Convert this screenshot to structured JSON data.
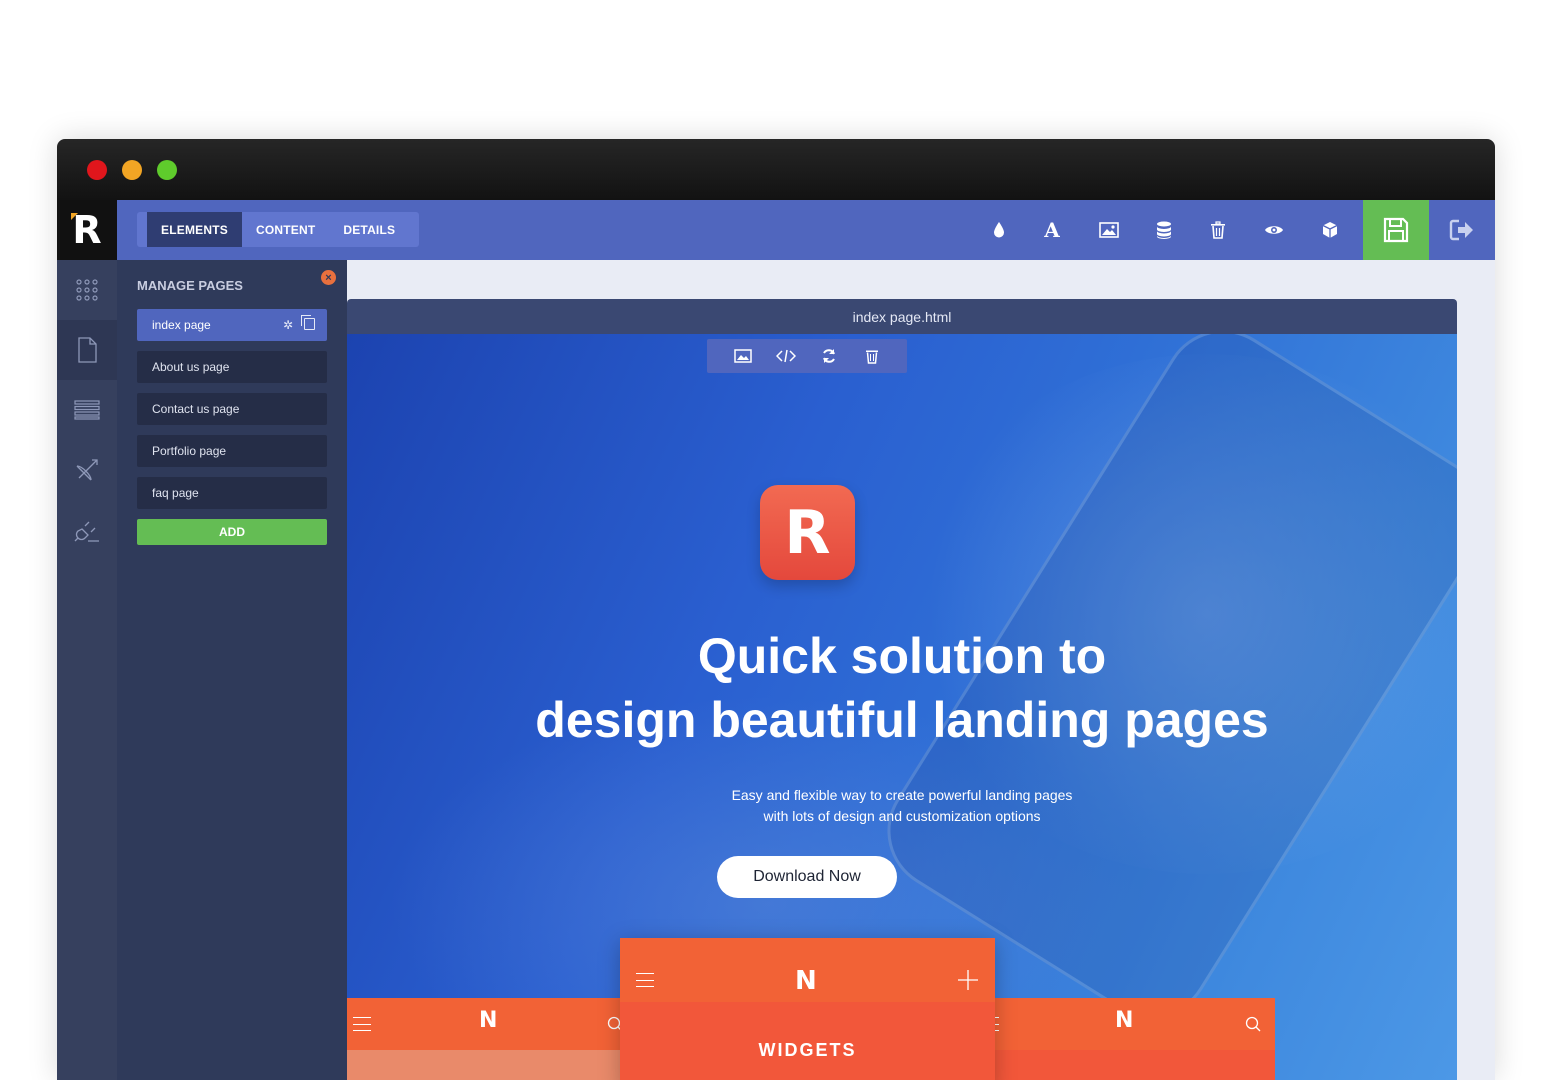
{
  "tabs": [
    "ELEMENTS",
    "CONTENT",
    "DETAILS"
  ],
  "toolbar_icons": [
    "droplet-icon",
    "font-icon",
    "image-icon",
    "database-icon",
    "trash-icon",
    "eye-icon",
    "cube-icon"
  ],
  "panel": {
    "title": "MANAGE PAGES",
    "pages": [
      "index page",
      "About us page",
      "Contact us page",
      "Portfolio page",
      "faq page"
    ],
    "add_label": "ADD"
  },
  "canvas": {
    "file_name": "index page.html"
  },
  "hero": {
    "logo_letter": "R",
    "headline_line1": "Quick solution to",
    "headline_line2": "design beautiful landing pages",
    "sub_line1": "Easy and flexible way to create powerful landing pages",
    "sub_line2": "with lots of design and customization options",
    "button": "Download Now"
  },
  "mockups": {
    "logo": "N",
    "center_title": "WIDGETS"
  },
  "brand": {
    "logo": "R"
  },
  "colors": {
    "accent": "#5066be",
    "save": "#64bd54",
    "sidebar": "#36405e",
    "panel": "#2f3a5a",
    "hero_primary": "#2a5fd0",
    "mock_orange": "#f26236"
  }
}
